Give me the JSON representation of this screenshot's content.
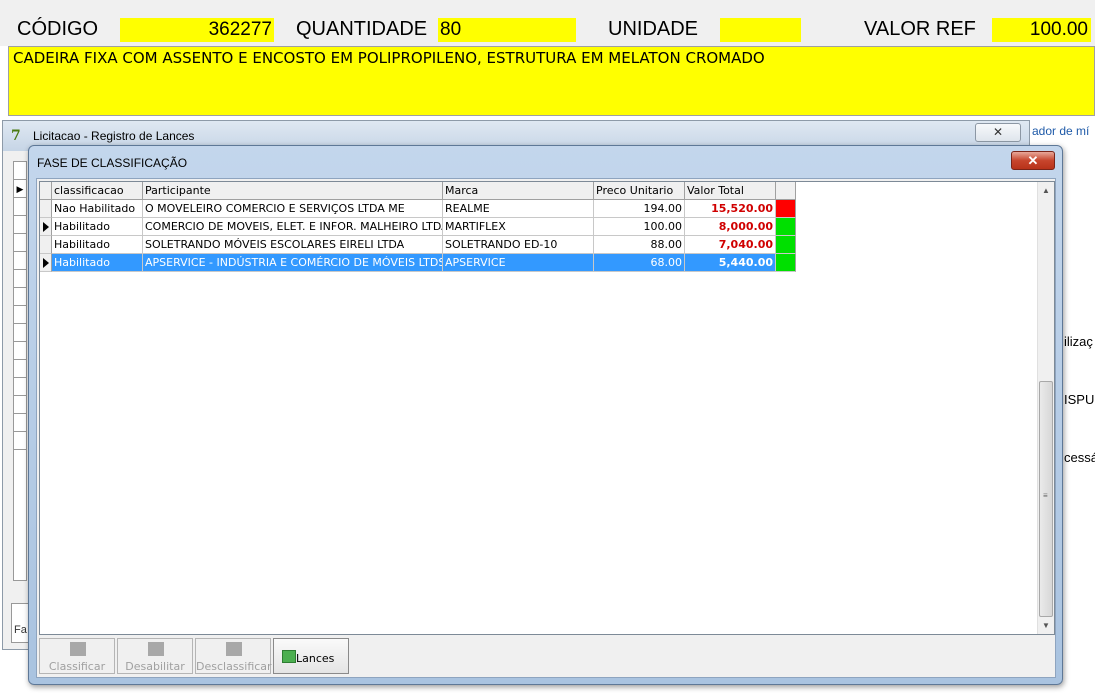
{
  "header": {
    "codigo_label": "CÓDIGO",
    "codigo_value": "362277",
    "quantidade_label": "QUANTIDADE",
    "quantidade_value": "80",
    "unidade_label": "UNIDADE",
    "unidade_value": "",
    "valor_ref_label": "VALOR REF",
    "valor_ref_value": "100.00",
    "description": "CADEIRA FIXA COM ASSENTO E ENCOSTO EM POLIPROPILENO, ESTRUTURA EM MELATON CROMADO"
  },
  "background_window": {
    "title": "Licitacao - Registro de Lances",
    "close_glyph": "✕",
    "bottom_label": "Fa"
  },
  "right_fragments": [
    "ador de mí",
    "ilizaç",
    "ISPU",
    "cessá"
  ],
  "dialog": {
    "title": "FASE DE CLASSIFICAÇÃO",
    "close_glyph": "✕",
    "columns": [
      "classificacao",
      "Participante",
      "Marca",
      "Preco Unitario",
      "Valor Total",
      ""
    ],
    "rows": [
      {
        "classificacao": "Nao Habilitado",
        "participante": "O MOVELEIRO COMERCIO E SERVIÇOS LTDA ME",
        "marca": "REALME",
        "preco": "194.00",
        "total": "15,520.00",
        "status_color": "#ff0000",
        "indicator": false,
        "selected": false
      },
      {
        "classificacao": "Habilitado",
        "participante": "COMERCIO DE MOVEIS, ELET. E INFOR. MALHEIRO LTDA",
        "marca": "MARTIFLEX",
        "preco": "100.00",
        "total": "8,000.00",
        "status_color": "#00e000",
        "indicator": true,
        "selected": false
      },
      {
        "classificacao": "Habilitado",
        "participante": "SOLETRANDO MÓVEIS ESCOLARES EIRELI LTDA",
        "marca": "SOLETRANDO ED-10",
        "preco": "88.00",
        "total": "7,040.00",
        "status_color": "#00e000",
        "indicator": false,
        "selected": false
      },
      {
        "classificacao": "Habilitado",
        "participante": "APSERVICE - INDÚSTRIA E COMÉRCIO DE MÓVEIS LTDS",
        "marca": "APSERVICE",
        "preco": "68.00",
        "total": "5,440.00",
        "status_color": "#00e000",
        "indicator": true,
        "selected": true
      }
    ],
    "toolbar": {
      "classificar": "Classificar",
      "desabilitar": "Desabilitar",
      "desclassificar": "Desclassificar",
      "lances": "Lances"
    }
  }
}
